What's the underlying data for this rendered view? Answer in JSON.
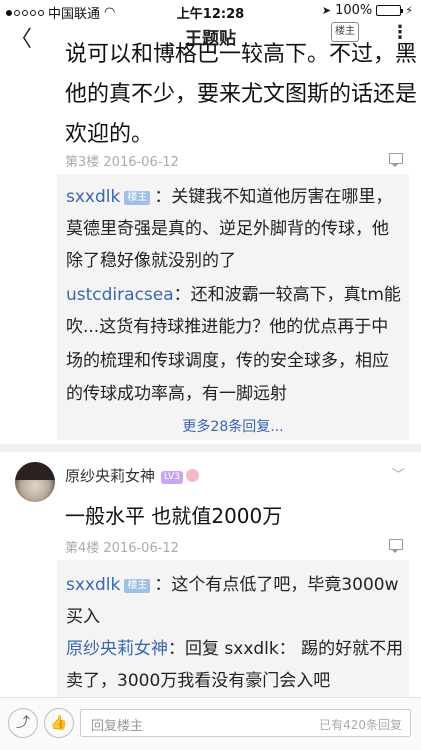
{
  "status_bar": {
    "carrier": "中国联通",
    "time": "上午12:28",
    "battery": "100%"
  },
  "nav": {
    "title": "王题贴",
    "owner_badge": "楼主",
    "back_icon": "chevron-left-icon",
    "more_icon": "more-vertical-icon"
  },
  "floor3": {
    "text_lines": [
      "说可以和博格巴一较高下。不过，黑",
      "他的真不少，要来尤文图斯的话还是",
      "欢迎的。"
    ],
    "meta": "第3楼  2016-06-12",
    "replies": [
      {
        "user": "sxxdlk",
        "tag": "楼主",
        "text": "：关键我不知道他厉害在哪里，"
      },
      {
        "text": "莫德里奇强是真的、逆足外脚背的传球，他"
      },
      {
        "text": "除了稳好像就没别的了"
      },
      {
        "user": "ustcdiracsea",
        "text": "：还和波霸一较高下，真tm能"
      },
      {
        "text": "吹...这货有持球推进能力？他的优点再于中"
      },
      {
        "text": "场的梳理和传球调度，传的安全球多，相应"
      },
      {
        "text": "的传球成功率高，有一脚远射"
      }
    ],
    "more_replies": "更多28条回复..."
  },
  "floor4": {
    "poster": "原纱央莉女神",
    "level": "LV3",
    "text": "一般水平 也就值2000万",
    "meta": "第4楼  2016-06-12",
    "replies": [
      {
        "user": "sxxdlk",
        "tag": "楼主",
        "text": "：这个有点低了吧，毕竟3000w"
      },
      {
        "text": "买入"
      },
      {
        "user": "原纱央莉女神",
        "text": "：回复 sxxdlk： 踢的好就不用"
      },
      {
        "text": "卖了，3000万我看没有豪门会入吧"
      }
    ]
  },
  "bottom_bar": {
    "share_icon": "share-icon",
    "like_icon": "thumbs-up-icon",
    "reply_placeholder": "回复楼主",
    "reply_count": "已有420条回复"
  },
  "colors": {
    "link": "#3a67b0",
    "reply_bg": "#f4f4f4",
    "tag_bg": "#9fc0e6"
  }
}
